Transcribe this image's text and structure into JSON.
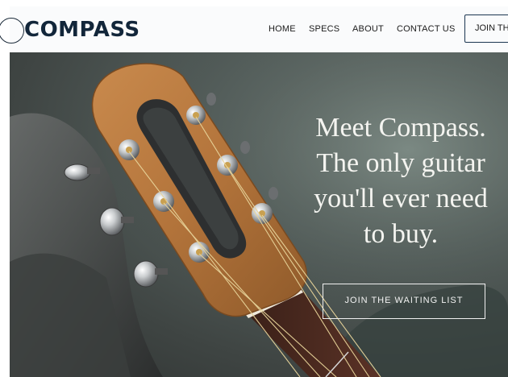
{
  "header": {
    "logo_text": "COMPASS",
    "nav": [
      "HOME",
      "SPECS",
      "ABOUT",
      "CONTACT US"
    ],
    "cta_label": "JOIN TH"
  },
  "hero": {
    "headline_lines": [
      "Meet Compass.",
      "The only guitar",
      "you'll ever need",
      "to buy."
    ],
    "cta_label": "JOIN THE WAITING LIST"
  },
  "colors": {
    "brand_navy": "#12263a",
    "hero_text": "#f4f4f0",
    "wood": "#b8773f"
  },
  "icons": [
    "logo-ring-icon"
  ]
}
